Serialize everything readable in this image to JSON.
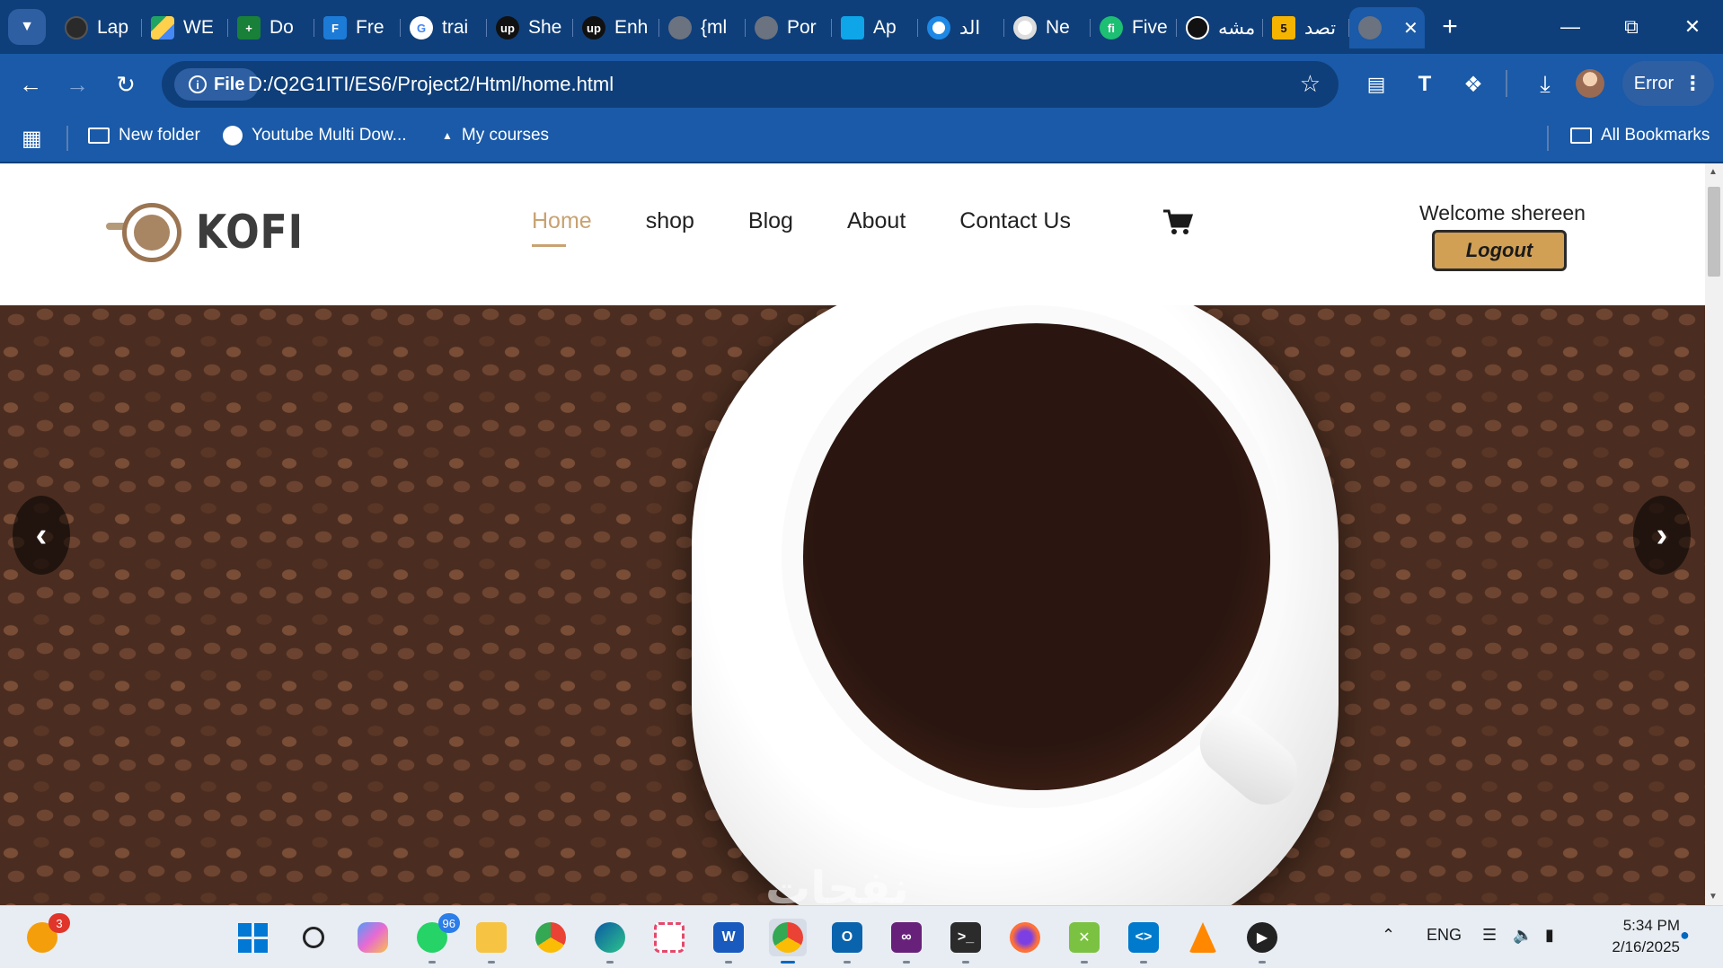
{
  "browser": {
    "tabs": [
      {
        "label": "Lap",
        "color": "#3a3a3a"
      },
      {
        "label": "WE",
        "color": "#1fa463"
      },
      {
        "label": "Do",
        "color": "#188038"
      },
      {
        "label": "Fre",
        "color": "#1d7bd8"
      },
      {
        "label": "trai",
        "color": "#ffffff"
      },
      {
        "label": "She",
        "color": "#111111"
      },
      {
        "label": "Enh",
        "color": "#111111"
      },
      {
        "label": "{ml",
        "color": "#6b7280"
      },
      {
        "label": "Por",
        "color": "#6b7280"
      },
      {
        "label": "Ap",
        "color": "#0ea5e9"
      },
      {
        "label": "الد",
        "color": "#1e88e5"
      },
      {
        "label": "Ne",
        "color": "#ffffff"
      },
      {
        "label": "Five",
        "color": "#1dbf73"
      },
      {
        "label": "مشه",
        "color": "#111111"
      },
      {
        "label": "تصد",
        "color": "#f5b400"
      }
    ],
    "tab_numbers": {
      "yellow_tab": "5"
    },
    "address": {
      "scheme_label": "File",
      "url": "D:/Q2G1ITI/ES6/Project2/Html/home.html"
    },
    "profile_button": "Error",
    "bookmarks": [
      {
        "label": "New folder",
        "icon": "folder-icon"
      },
      {
        "label": "Youtube Multi Dow...",
        "icon": "globe-icon"
      },
      {
        "label": "My courses",
        "icon": "triangle-icon"
      }
    ],
    "all_bookmarks": "All Bookmarks"
  },
  "site": {
    "logo_text": "KOFI",
    "nav": [
      "Home",
      "shop",
      "Blog",
      "About",
      "Contact Us"
    ],
    "active_nav": "Home",
    "welcome": "Welcome shereen",
    "logout": "Logout",
    "hero_caption": "نفحات",
    "accent_color": "#c8a272",
    "button_color": "#d1a055"
  },
  "taskbar": {
    "notification_badge": "3",
    "whatsapp_badge": "96",
    "language": "ENG",
    "time": "5:34 PM",
    "date": "2/16/2025"
  }
}
